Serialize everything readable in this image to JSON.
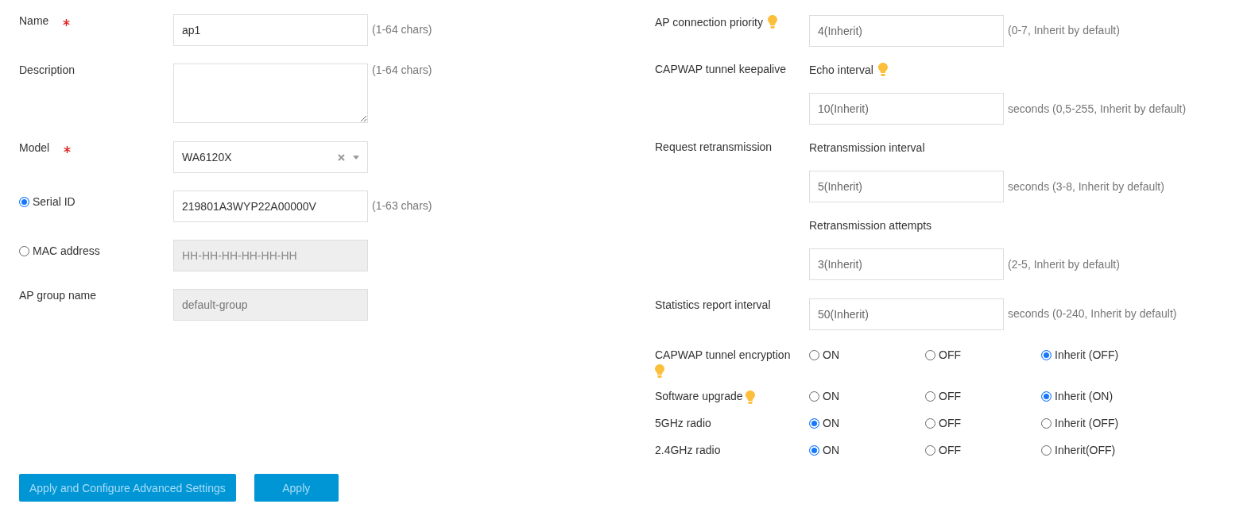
{
  "left_fields": [
    {
      "kind": "text",
      "label": "Name",
      "required": true,
      "disabled": false,
      "value": "ap1",
      "hint": "(1-64 chars)"
    },
    {
      "kind": "textarea",
      "label": "Description",
      "required": false,
      "disabled": false,
      "hint": "(1-64 chars)"
    },
    {
      "kind": "select",
      "label": "Model",
      "required": true,
      "disabled": false,
      "value": "WA6120X"
    },
    {
      "kind": "choice",
      "label": "Serial ID",
      "selected": true,
      "required": false,
      "disabled": false,
      "value": "219801A3WYP22A00000V",
      "hint": "(1-63 chars)"
    },
    {
      "kind": "choice",
      "label": "MAC address",
      "selected": false,
      "required": false,
      "disabled": true,
      "placeholder": "HH-HH-HH-HH-HH-HH"
    },
    {
      "kind": "text",
      "label": "AP group name",
      "required": false,
      "disabled": true,
      "value": "default-group"
    }
  ],
  "buttons": [
    "Apply and Configure Advanced Settings",
    "Apply"
  ],
  "settings": [
    {
      "kind": "input",
      "label": "AP connection priority",
      "tip": true,
      "value": "4(Inherit)",
      "hint": "(0-7, Inherit by default)"
    },
    {
      "kind": "group",
      "label": "CAPWAP tunnel keepalive",
      "tip": false,
      "items": [
        {
          "label": "Echo interval",
          "tip": true,
          "value": "10(Inherit)",
          "hint": "seconds (0,5-255, Inherit by default)"
        }
      ]
    },
    {
      "kind": "group",
      "label": "Request retransmission",
      "tip": false,
      "items": [
        {
          "label": "Retransmission interval",
          "tip": false,
          "value": "5(Inherit)",
          "hint": "seconds (3-8, Inherit by default)"
        },
        {
          "label": "Retransmission attempts",
          "tip": false,
          "value": "3(Inherit)",
          "hint": "(2-5, Inherit by default)"
        }
      ]
    },
    {
      "kind": "input",
      "label": "Statistics report interval",
      "tip": false,
      "value": "50(Inherit)",
      "hint": "seconds (0-240, Inherit by default)"
    },
    {
      "kind": "radio",
      "label": "CAPWAP tunnel encryption",
      "tip": true,
      "options": [
        {
          "label": "ON",
          "selected": false
        },
        {
          "label": "OFF",
          "selected": false
        },
        {
          "label": "Inherit (OFF)",
          "selected": true
        }
      ]
    },
    {
      "kind": "radio",
      "label": "Software upgrade",
      "tip": true,
      "options": [
        {
          "label": "ON",
          "selected": false
        },
        {
          "label": "OFF",
          "selected": false
        },
        {
          "label": "Inherit (ON)",
          "selected": true
        }
      ]
    },
    {
      "kind": "radio",
      "label": "5GHz radio",
      "tip": false,
      "options": [
        {
          "label": "ON",
          "selected": true
        },
        {
          "label": "OFF",
          "selected": false
        },
        {
          "label": "Inherit (OFF)",
          "selected": false
        }
      ]
    },
    {
      "kind": "radio",
      "label": "2.4GHz radio",
      "tip": false,
      "options": [
        {
          "label": "ON",
          "selected": true
        },
        {
          "label": "OFF",
          "selected": false
        },
        {
          "label": "Inherit(OFF)",
          "selected": false
        }
      ]
    }
  ]
}
